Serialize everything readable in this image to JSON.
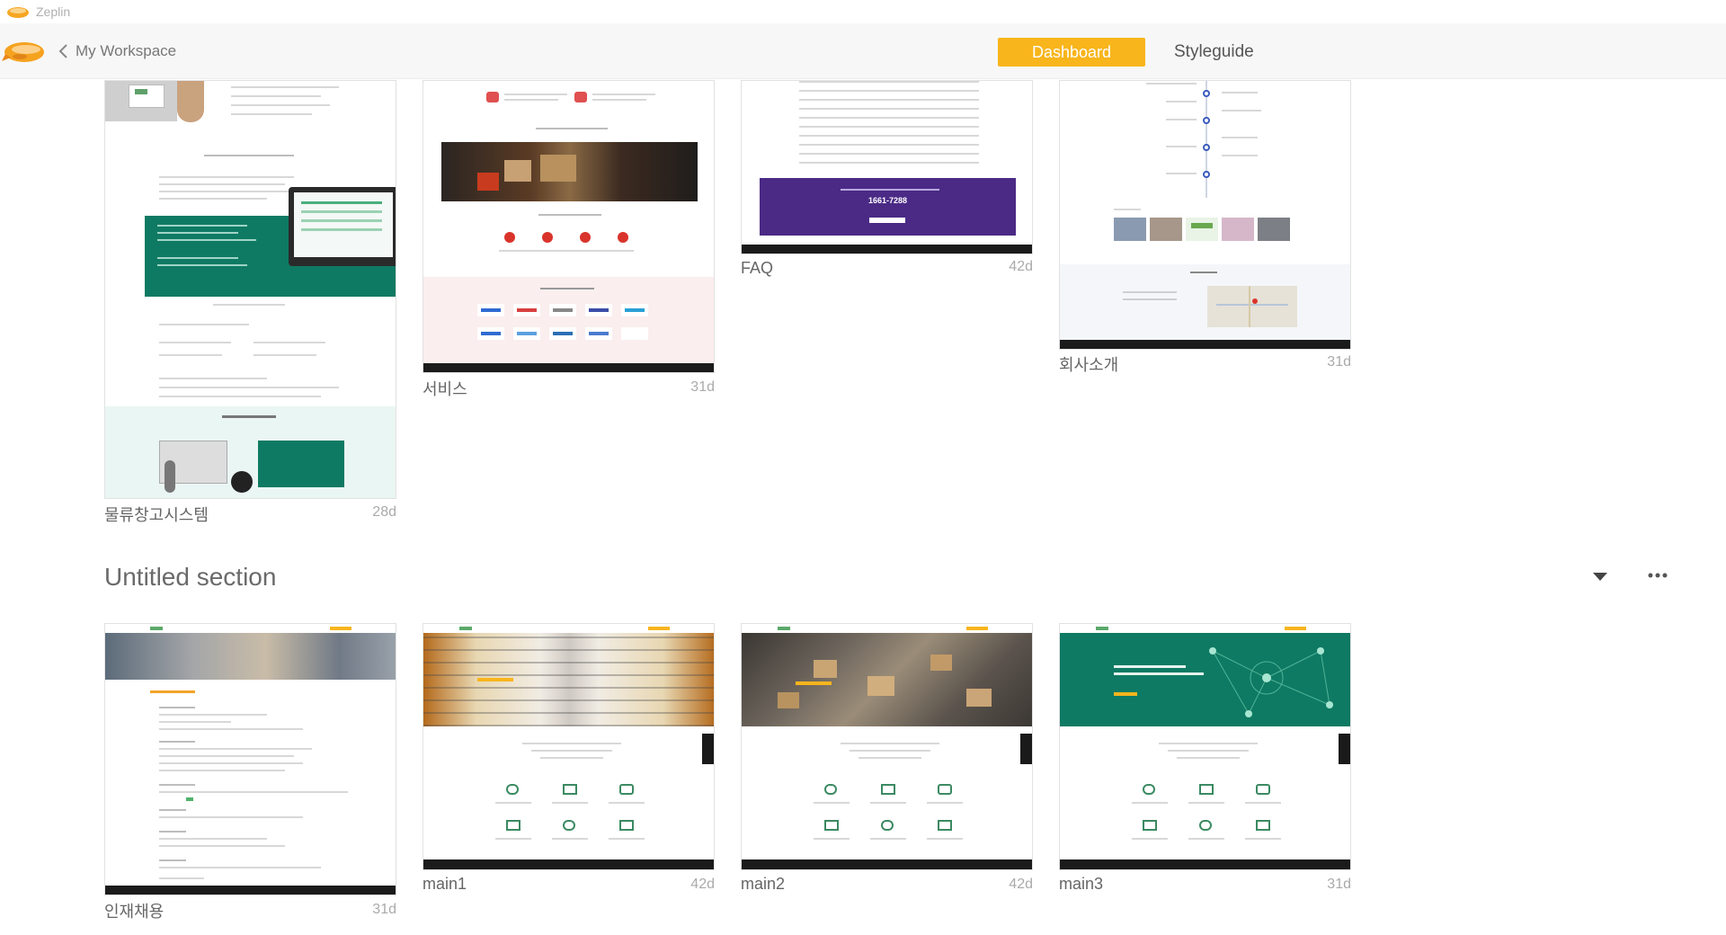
{
  "window": {
    "app_name": "Zeplin"
  },
  "header": {
    "back_label": "My Workspace",
    "tabs": [
      {
        "label": "Dashboard",
        "active": true
      },
      {
        "label": "Styleguide",
        "active": false
      }
    ]
  },
  "top_screens": [
    {
      "name": "물류창고시스템",
      "age": "28d"
    },
    {
      "name": "서비스",
      "age": "31d"
    },
    {
      "name": "FAQ",
      "age": "42d"
    },
    {
      "name": "회사소개",
      "age": "31d"
    }
  ],
  "section": {
    "title": "Untitled section",
    "screens": [
      {
        "name": "인재채용",
        "age": "31d"
      },
      {
        "name": "main1",
        "age": "42d"
      },
      {
        "name": "main2",
        "age": "42d"
      },
      {
        "name": "main3",
        "age": "31d"
      }
    ]
  },
  "thumbnail_text": {
    "faq_phone": "1661-7288"
  },
  "colors": {
    "accent": "#f8b51c",
    "teal": "#0f7a63",
    "purple": "#4b2a86",
    "footer": "#1b1b1b"
  }
}
